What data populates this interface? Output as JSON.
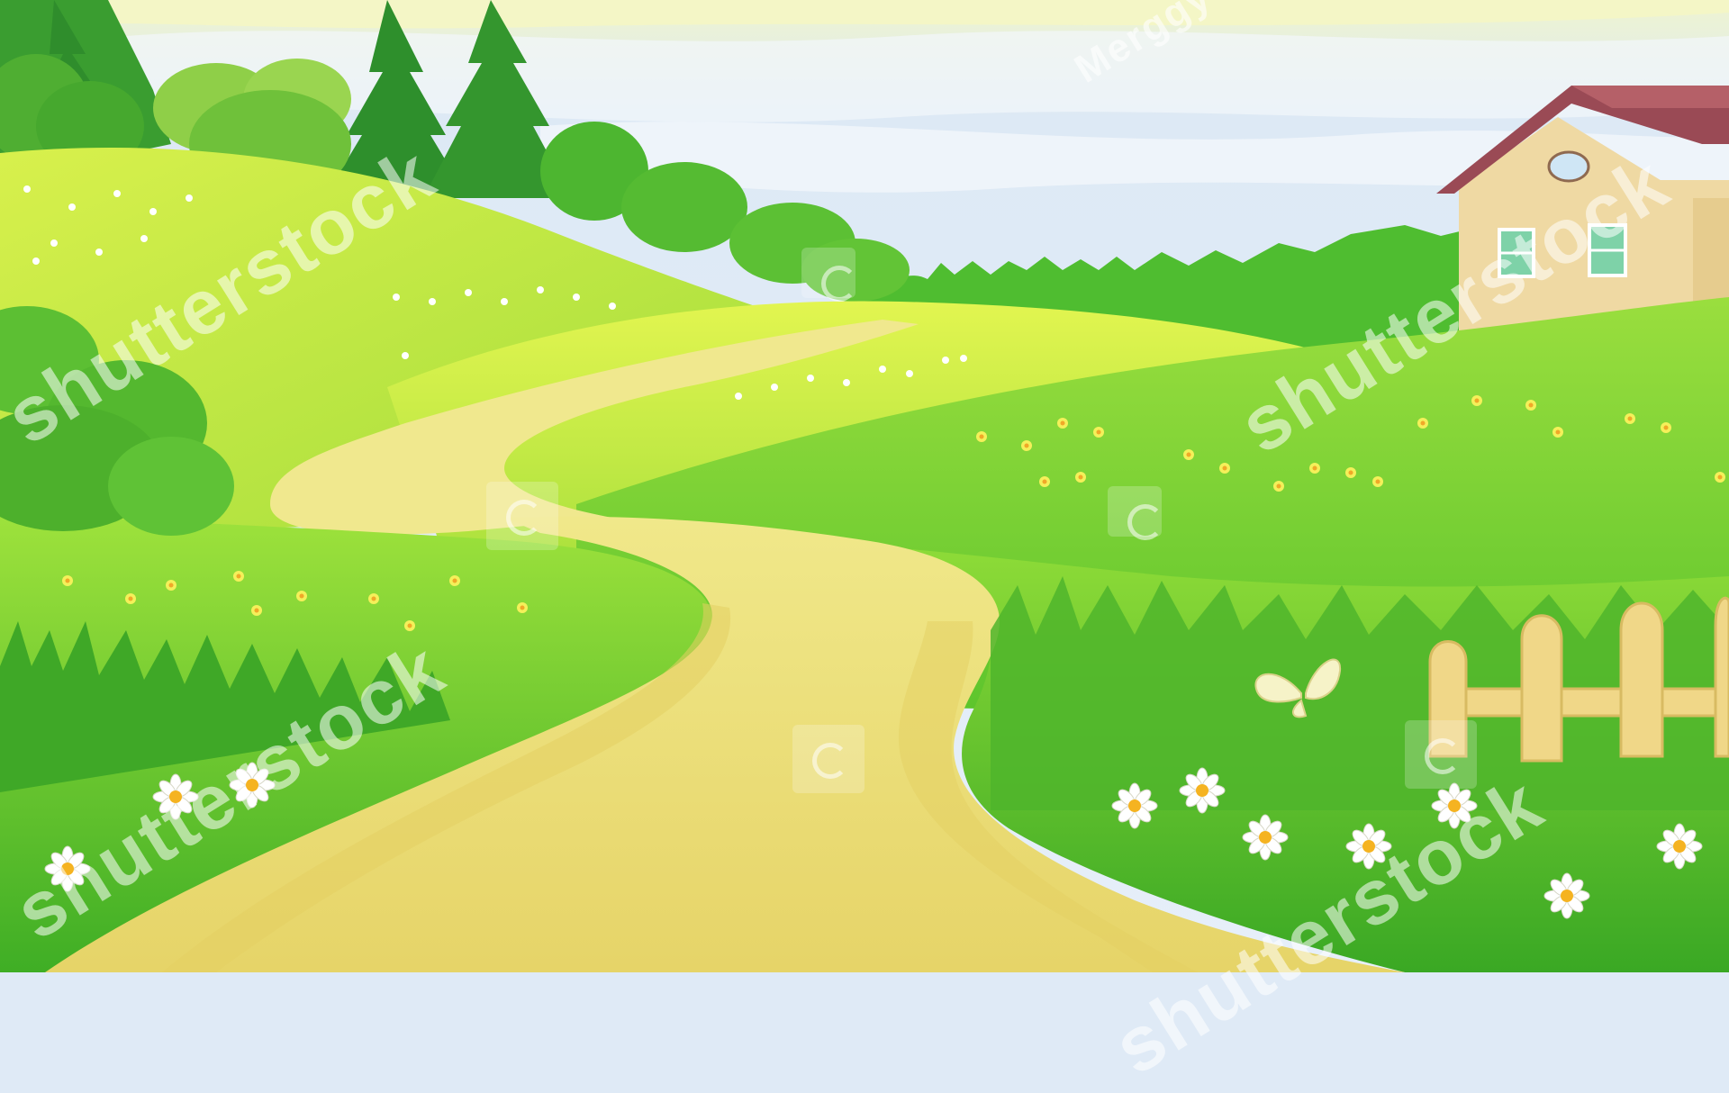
{
  "scene": {
    "description_icons": [
      "tree-icon",
      "house-icon",
      "fence-icon",
      "daisy-icon",
      "butterfly-icon"
    ],
    "colors": {
      "sky": "#e4eef8",
      "haze": "#f6f7cc",
      "grass_light": "#d9f24a",
      "grass_mid": "#8fd63a",
      "grass_dark": "#46b227",
      "tree_dark": "#2e8f2c",
      "path": "#e8da6e",
      "house_wall": "#efd9a3",
      "roof": "#9a4a55",
      "fence": "#f0d788",
      "daisy_center": "#f5b321"
    }
  },
  "watermark": {
    "brand": "shutterstock",
    "credit": "Merggy"
  }
}
